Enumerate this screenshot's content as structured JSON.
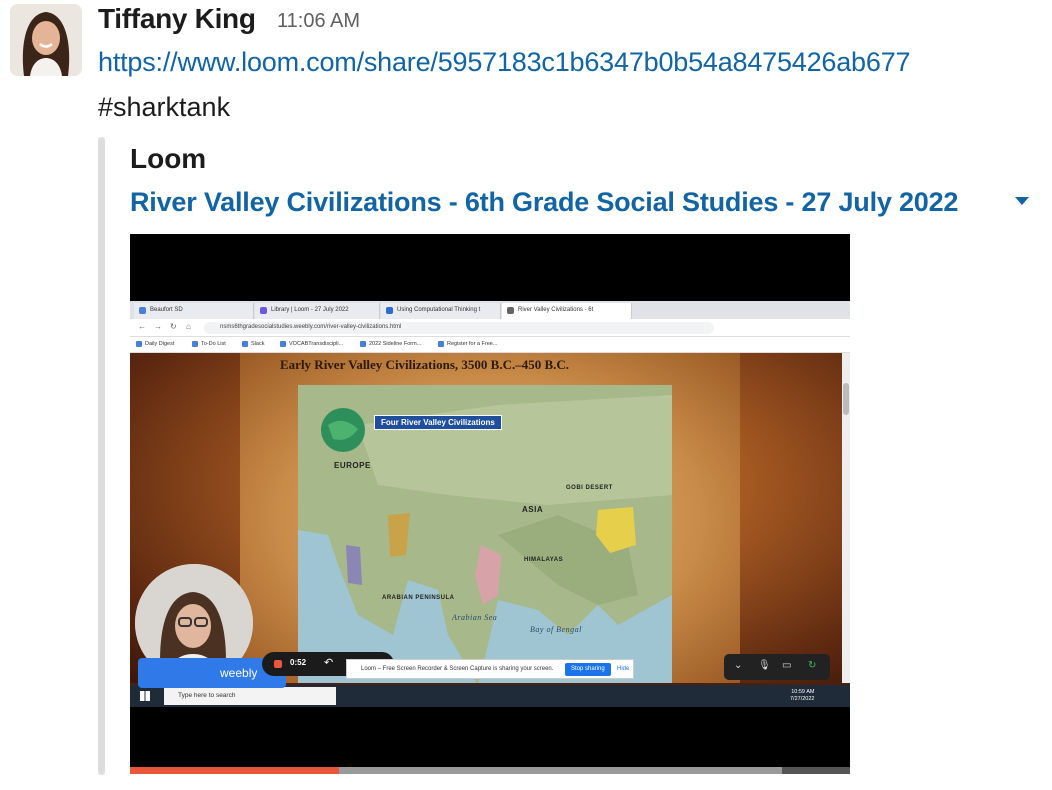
{
  "message": {
    "sender": "Tiffany King",
    "time": "11:06 AM",
    "link": "https://www.loom.com/share/5957183c1b6347b0b54a8475426ab677",
    "hashtag": "#sharktank"
  },
  "unfurl": {
    "provider": "Loom",
    "title": "River Valley Civilizations - 6th Grade Social Studies - 27 July 2022"
  },
  "video": {
    "progress_played": 0.29,
    "progress_buffered_start": 0.29,
    "progress_buffered_end": 0.905,
    "browser": {
      "tabs": [
        "Beaufort SD",
        "Library | Loom - 27 July 2022",
        "Using Computational Thinking t",
        "River Valley Civilizations - 6t"
      ],
      "url": "nsms6thgradesocialstudies.weebly.com/river-valley-civilizations.html",
      "bookmarks": [
        "Daily Digest",
        "To-Do List",
        "Slack",
        "VOCABTransdiscipli...",
        "2022 Sideline Form...",
        "Register for a Free..."
      ]
    },
    "page": {
      "heading": "Early River Valley Civilizations, 3500 B.C.–450 B.C.",
      "map_banner": "Four River Valley Civilizations",
      "map_labels": {
        "europe": "EUROPE",
        "asia": "ASIA",
        "arabian_sea": "Arabian Sea",
        "bay_of_bengal": "Bay of Bengal",
        "himalayas": "HIMALAYAS",
        "gobi": "GOBI DESERT",
        "arabian_peninsula": "ARABIAN PENINSULA"
      }
    },
    "recorder": {
      "time": "0:52",
      "weebly_label": "weebly",
      "share_notice": "Loom – Free Screen Recorder & Screen Capture is sharing your screen.",
      "stop_label": "Stop sharing",
      "hide_label": "Hide"
    },
    "taskbar": {
      "search_placeholder": "Type here to search",
      "clock_time": "10:59 AM",
      "clock_date": "7/27/2022"
    }
  }
}
